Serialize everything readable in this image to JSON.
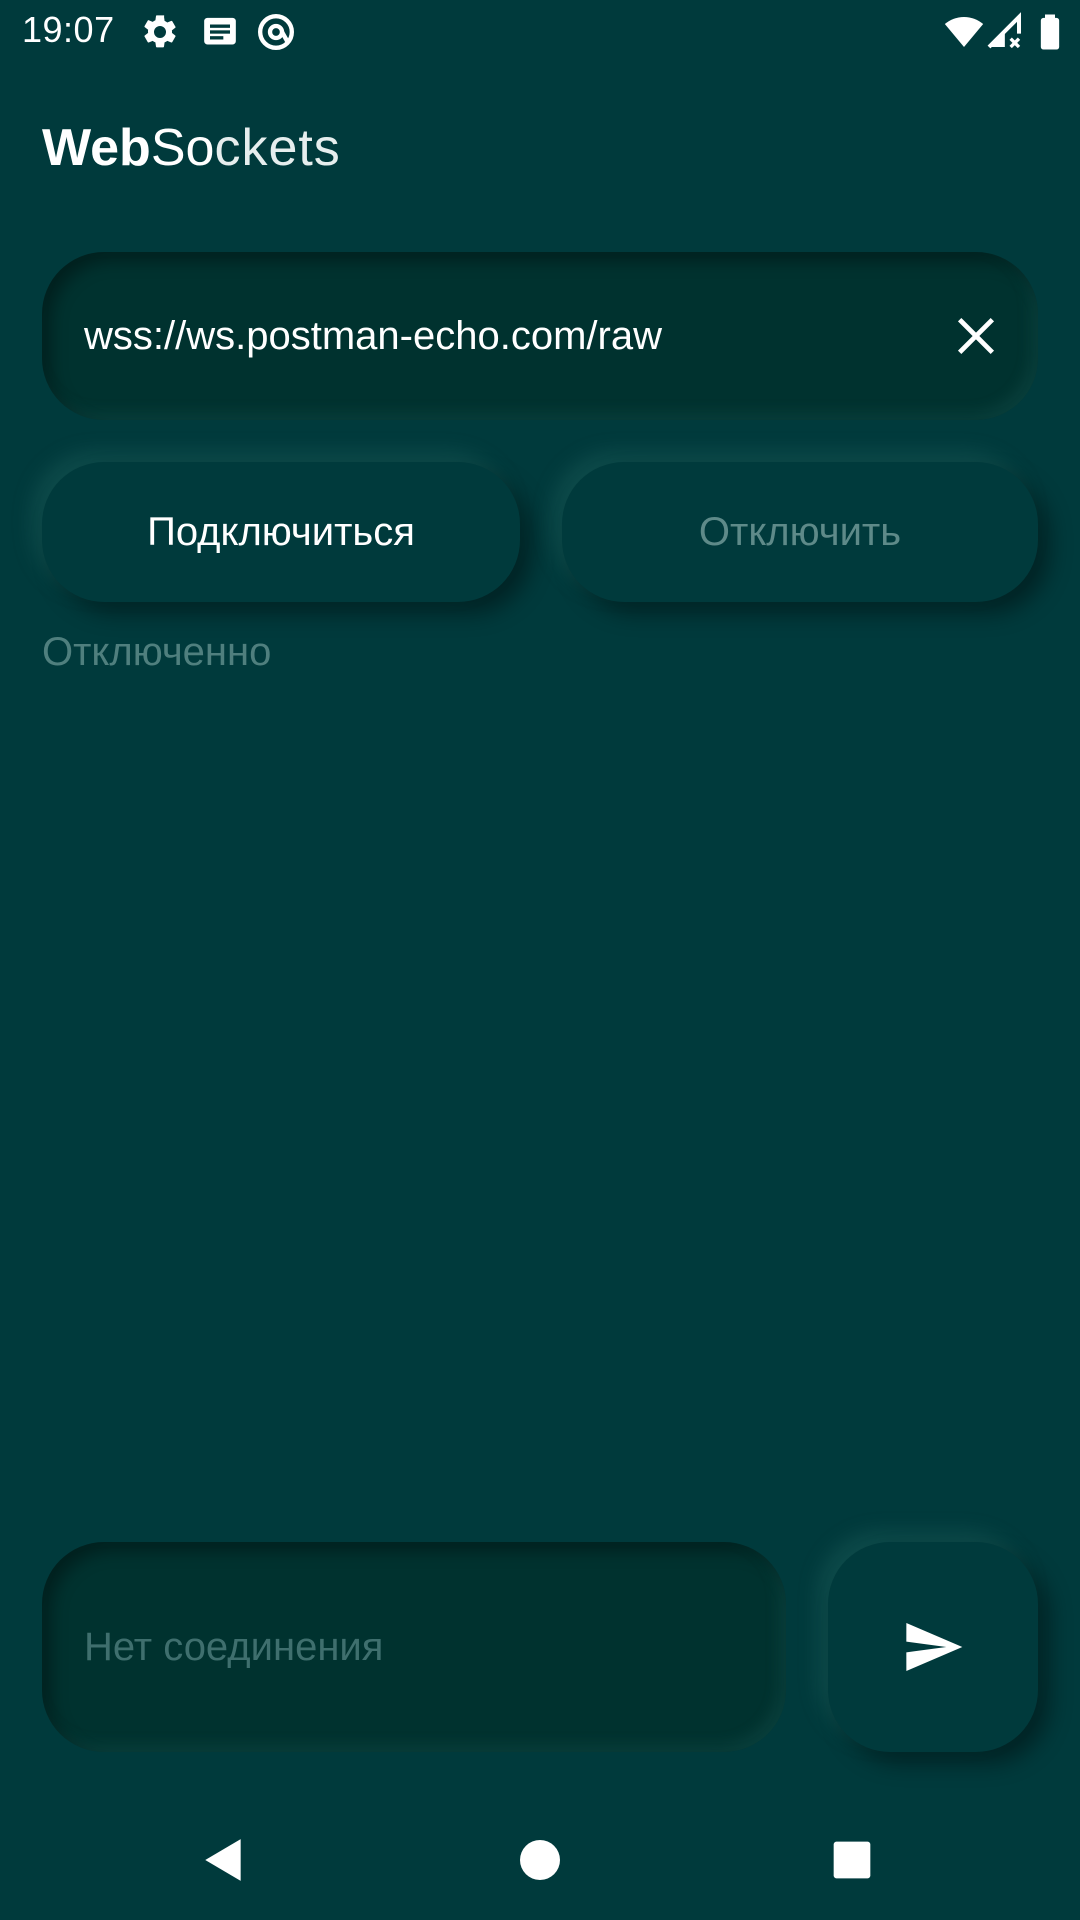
{
  "status_bar": {
    "time": "19:07",
    "icons": [
      "settings-icon",
      "notes-icon",
      "at-sign-icon",
      "wifi-icon",
      "signal-icon",
      "battery-icon"
    ]
  },
  "app": {
    "title_bold": "Web",
    "title_mid": "So",
    "title_light": "ckets"
  },
  "url_field": {
    "value": "wss://ws.postman-echo.com/raw",
    "clear_icon": "close-icon"
  },
  "buttons": {
    "connect_label": "Подключиться",
    "disconnect_label": "Отключить"
  },
  "connection": {
    "status_text": "Отключенно"
  },
  "message_input": {
    "placeholder": "Нет соединения",
    "send_icon": "send-icon"
  },
  "nav_bar": {
    "icons": [
      "back-icon",
      "home-icon",
      "recents-icon"
    ]
  },
  "colors": {
    "background": "#003a3c",
    "text_primary": "#ffffff",
    "text_disabled": "#5e8a89",
    "text_muted": "#4f7f7e"
  }
}
